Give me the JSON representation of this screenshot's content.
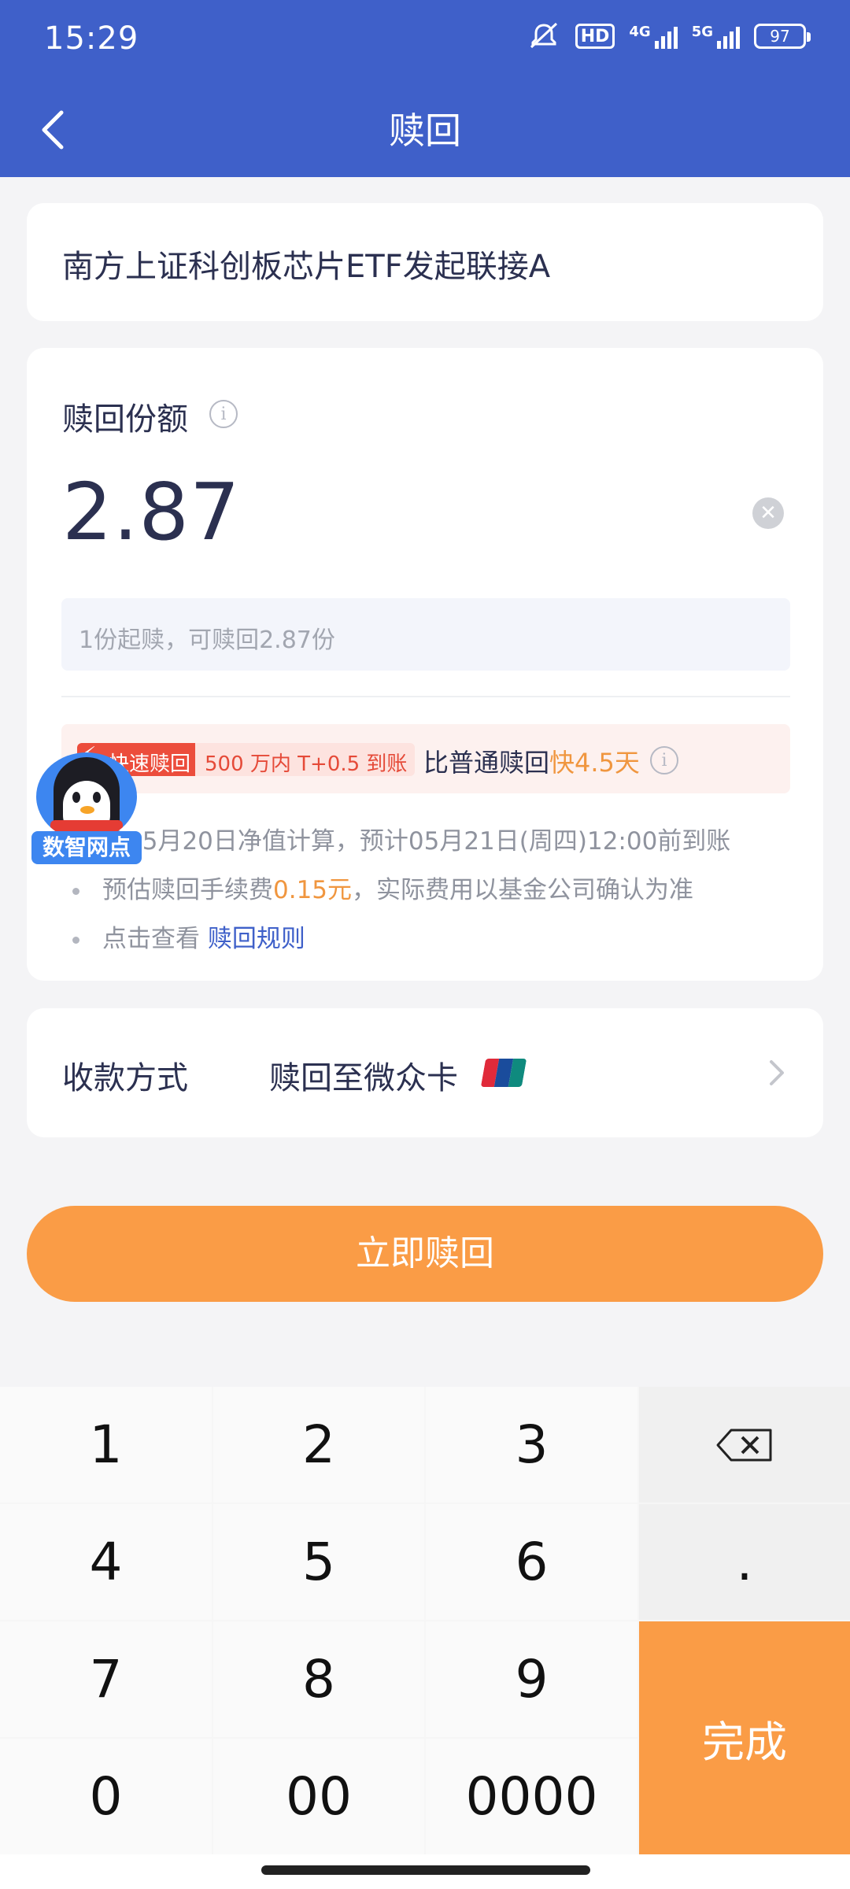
{
  "status_bar": {
    "time": "15:29",
    "network_1": "4G",
    "network_2": "5G",
    "hd_label": "HD",
    "battery": "97"
  },
  "header": {
    "title": "赎回",
    "back_icon": "chevron-left-icon"
  },
  "fund": {
    "name": "南方上证科创板芯片ETF发起联接A"
  },
  "redeem_amount": {
    "label": "赎回份额",
    "value": "2.87",
    "hint": "1份起赎，可赎回2.87份",
    "fast_tag": "快速赎回",
    "fast_condition": "500 万内 T+0.5 到账",
    "compare_prefix": "比普通赎回",
    "compare_highlight": "快4.5天",
    "notes": {
      "nav_calc": "按05月20日净值计算，预计05月21日(周四)12:00前到账",
      "fee_prefix": "预估赎回手续费",
      "fee_value": "0.15元",
      "fee_suffix": "，实际费用以基金公司确认为准",
      "rules_prefix": "点击查看 ",
      "rules_link": "赎回规则"
    }
  },
  "mascot": {
    "label": "数智网点"
  },
  "payment": {
    "label": "收款方式",
    "value": "赎回至微众卡",
    "card_icon": "unionpay-icon",
    "colors": [
      "#e02a3a",
      "#1a4c9c",
      "#0f8a7e"
    ]
  },
  "primary_button": {
    "label": "立即赎回",
    "color": "#fa9c46"
  },
  "keypad": {
    "keys": [
      "1",
      "2",
      "3",
      "4",
      "5",
      "6",
      "7",
      "8",
      "9",
      "0",
      "00",
      "0000"
    ],
    "dot": ".",
    "done": "完成",
    "backspace_icon": "backspace-icon"
  }
}
